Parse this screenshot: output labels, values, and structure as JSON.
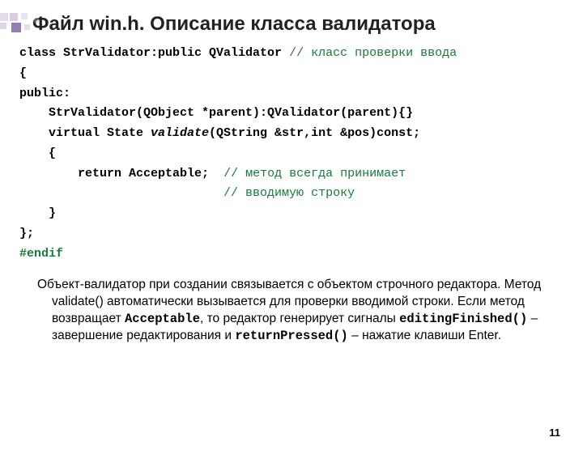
{
  "title": "Файл win.h. Описание класса валидатора",
  "code": {
    "l1a": "class StrValidator:public QValidator ",
    "l1b": "// класс проверки ввода",
    "l2": "{",
    "l3": "public:",
    "l4": "    StrValidator(QObject *parent):QValidator(parent){}",
    "l5a": "    virtual State ",
    "l5b": "validate",
    "l5c": "(QString &str,int &pos)const;",
    "l6": "    {",
    "l7a": "        ",
    "l7b": "return",
    "l7c": " Acceptable;  ",
    "l7d": "// метод всегда принимает",
    "l8a": "                            ",
    "l8b": "// вводимую строку",
    "l9": "    }",
    "l10": "};",
    "l11": "#endif"
  },
  "para": {
    "t1": "Объект-валидатор при создании связывается с объектом строчного редактора. Метод validate() автоматически вызывается для проверки вводимой строки. Если метод возвращает ",
    "m1": "Acceptable",
    "t2": ", то редактор генерирует сигналы ",
    "m2": "editingFinished()",
    "t3": " – завершение редактирования и ",
    "m3": "returnPressed()",
    "t4": " – нажатие клавиши Enter.",
    "bold_end": "."
  },
  "pagenum": "11"
}
